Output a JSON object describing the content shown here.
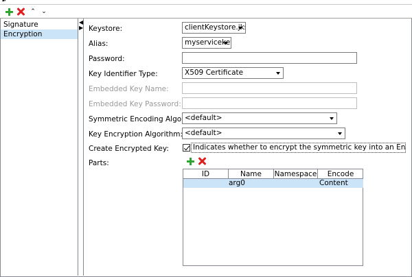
{
  "toolbar": {
    "collapse_arrows": "▴▾",
    "up_glyph": "▲",
    "down_glyph": "▼"
  },
  "sidebar": {
    "items": [
      {
        "label": "Signature",
        "selected": false
      },
      {
        "label": "Encryption",
        "selected": true
      }
    ]
  },
  "splitter": {
    "arrow": "▶"
  },
  "form": {
    "keystore": {
      "label": "Keystore:",
      "value": "clientKeystore.jks"
    },
    "alias": {
      "label": "Alias:",
      "value": "myservicekey"
    },
    "password": {
      "label": "Password:",
      "value": ""
    },
    "key_identifier_type": {
      "label": "Key Identifier Type:",
      "value": "X509 Certificate"
    },
    "embedded_key_name": {
      "label": "Embedded Key Name:",
      "value": ""
    },
    "embedded_key_password": {
      "label": "Embedded Key Password:",
      "value": ""
    },
    "symmetric_encoding_algorithm": {
      "label": "Symmetric Encoding Algorithm:",
      "value": "<default>"
    },
    "key_encryption_algorithm": {
      "label": "Key Encryption Algorithm:",
      "value": "<default>"
    },
    "create_encrypted_key": {
      "label": "Create Encrypted Key:",
      "checked": true,
      "description": "Indicates whether to encrypt the symmetric key into an EncryptedKey or not"
    },
    "parts": {
      "label": "Parts:",
      "columns": [
        "ID",
        "Name",
        "Namespace",
        "Encode"
      ],
      "rows": [
        {
          "id": "",
          "name": "arg0",
          "namespace": "",
          "encode": "Content"
        }
      ]
    }
  },
  "colors": {
    "selection": "#cce4f7",
    "add_green": "#2ea52e",
    "remove_red": "#dd1f1f",
    "border": "#828790"
  }
}
